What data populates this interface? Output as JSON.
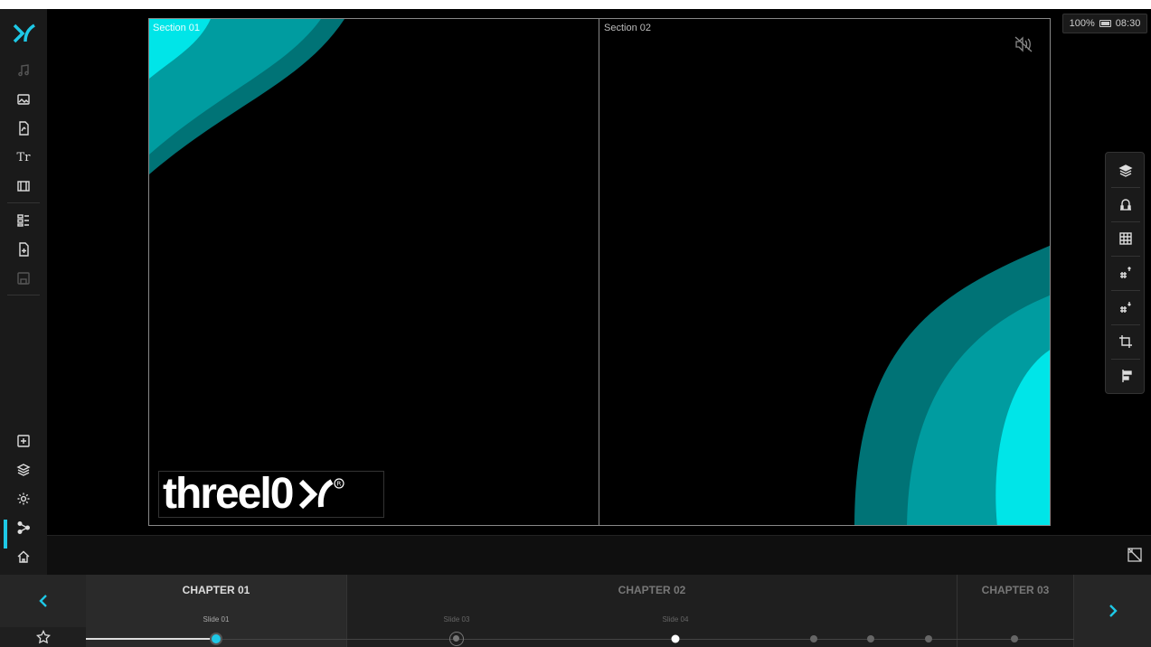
{
  "status": {
    "battery_level": "100%",
    "time": "08:30"
  },
  "canvas": {
    "sections": [
      {
        "label": "Section 01"
      },
      {
        "label": "Section 02"
      }
    ],
    "brand_text": "threel0",
    "wave_colors": [
      "#00e5e8",
      "#009ca0",
      "#007376"
    ]
  },
  "sidebar": {
    "top_items": [
      "music-icon",
      "image-icon",
      "pdf-icon",
      "text-icon",
      "video-icon",
      "template-icon",
      "add-page-icon",
      "save-icon"
    ],
    "bottom_items": [
      "add-widget-icon",
      "layers-icon",
      "settings-icon",
      "share-icon",
      "home-icon"
    ]
  },
  "right_toolbar": {
    "items": [
      "layers-icon",
      "magnet-icon",
      "grid-icon",
      "number-up-icon",
      "number-down-icon",
      "crop-icon",
      "align-icon"
    ]
  },
  "chapters": [
    {
      "title": "CHAPTER 01",
      "active": true
    },
    {
      "title": "CHAPTER 02",
      "active": false
    },
    {
      "title": "CHAPTER 03",
      "active": false
    }
  ],
  "slides": [
    {
      "label": "Slide 01",
      "active": true
    },
    {
      "label": "Slide 03",
      "active": false
    },
    {
      "label": "Slide 04",
      "active": false
    }
  ],
  "colors": {
    "accent": "#1ec8e6"
  }
}
